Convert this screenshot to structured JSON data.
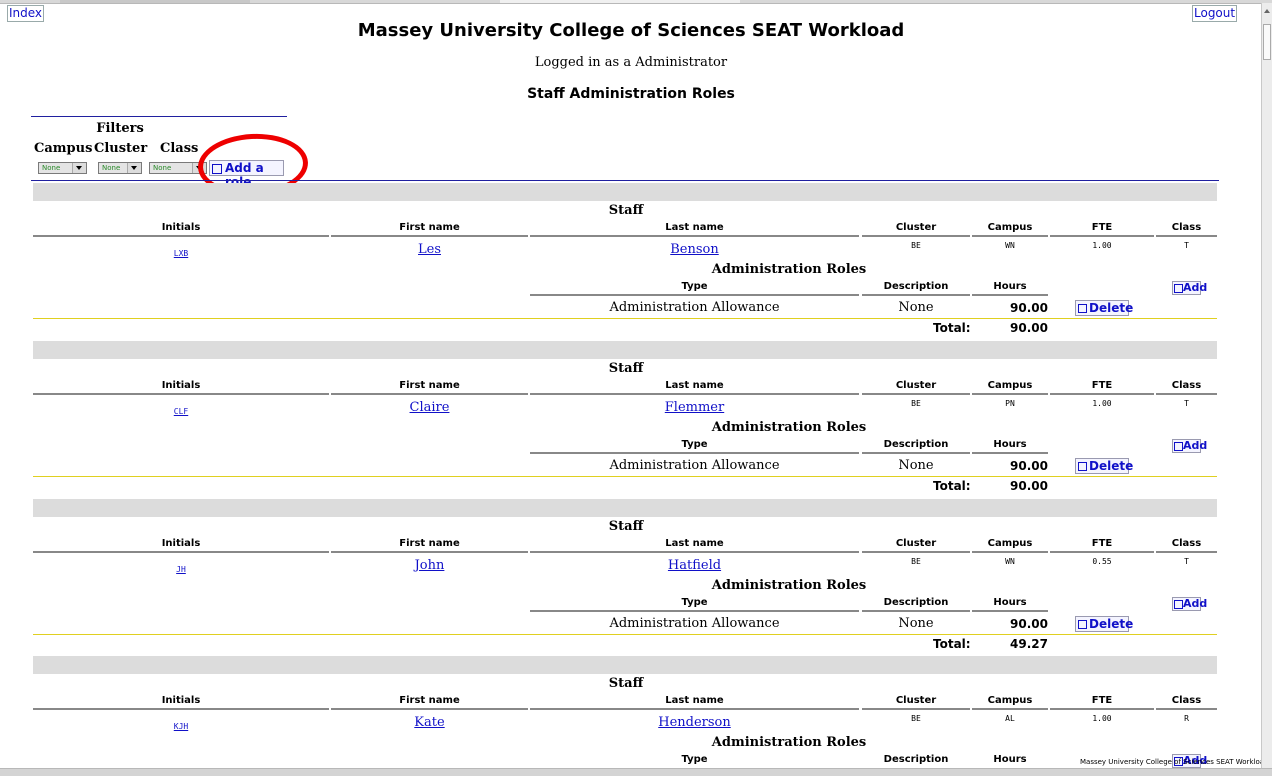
{
  "header": {
    "index_link": "Index",
    "logout_link": "Logout",
    "title": "Massey University College of Sciences SEAT Workload",
    "logged_in": "Logged in as a Administrator",
    "section": "Staff Administration Roles"
  },
  "filters": {
    "label": "Filters",
    "campus_label": "Campus",
    "cluster_label": "Cluster",
    "class_label": "Class",
    "campus_value": "None",
    "cluster_value": "None",
    "class_value": "None",
    "add_role_label": "Add a role"
  },
  "columns": {
    "staff_label": "Staff",
    "initials": "Initials",
    "first_name": "First name",
    "last_name": "Last name",
    "cluster": "Cluster",
    "campus": "Campus",
    "fte": "FTE",
    "class": "Class",
    "admin_roles": "Administration Roles",
    "type": "Type",
    "description": "Description",
    "hours": "Hours",
    "add_label": "Add",
    "delete_label": "Delete",
    "total_label": "Total:"
  },
  "staff": [
    {
      "initials": "LXB",
      "first": "Les",
      "last": "Benson",
      "cluster": "BE",
      "campus": "WN",
      "fte": "1.00",
      "class": "T",
      "role_type": "Administration Allowance",
      "role_desc": "None",
      "role_hours": "90.00",
      "total": "90.00"
    },
    {
      "initials": "CLF",
      "first": "Claire",
      "last": "Flemmer",
      "cluster": "BE",
      "campus": "PN",
      "fte": "1.00",
      "class": "T",
      "role_type": "Administration Allowance",
      "role_desc": "None",
      "role_hours": "90.00",
      "total": "90.00"
    },
    {
      "initials": "JH",
      "first": "John",
      "last": "Hatfield",
      "cluster": "BE",
      "campus": "WN",
      "fte": "0.55",
      "class": "T",
      "role_type": "Administration Allowance",
      "role_desc": "None",
      "role_hours": "90.00",
      "total": "49.27"
    },
    {
      "initials": "KJH",
      "first": "Kate",
      "last": "Henderson",
      "cluster": "BE",
      "campus": "AL",
      "fte": "1.00",
      "class": "R"
    }
  ],
  "footer": {
    "text": "Massey University College of Sciences SEAT Workload"
  }
}
